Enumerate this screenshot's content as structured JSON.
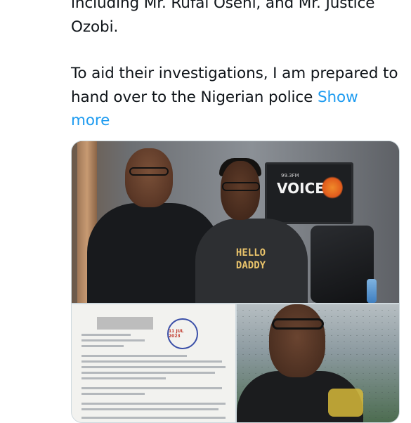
{
  "post": {
    "line_1": "including Mr. Rufai Oseni, and Mr. Justice Ozobi.",
    "paragraph_2": "To aid their investigations, I am prepared to hand over to the Nigerian police",
    "show_more": "Show more"
  },
  "media": {
    "monitor_logo": "VOICE",
    "monitor_freq": "99.3FM",
    "shirt_line_1": "HELLO",
    "shirt_line_2": "DADDY",
    "doc_stamp": "11 JUL 2023"
  },
  "colors": {
    "text": "#0f1419",
    "link": "#1d9bf0",
    "border": "#cfd9de"
  }
}
